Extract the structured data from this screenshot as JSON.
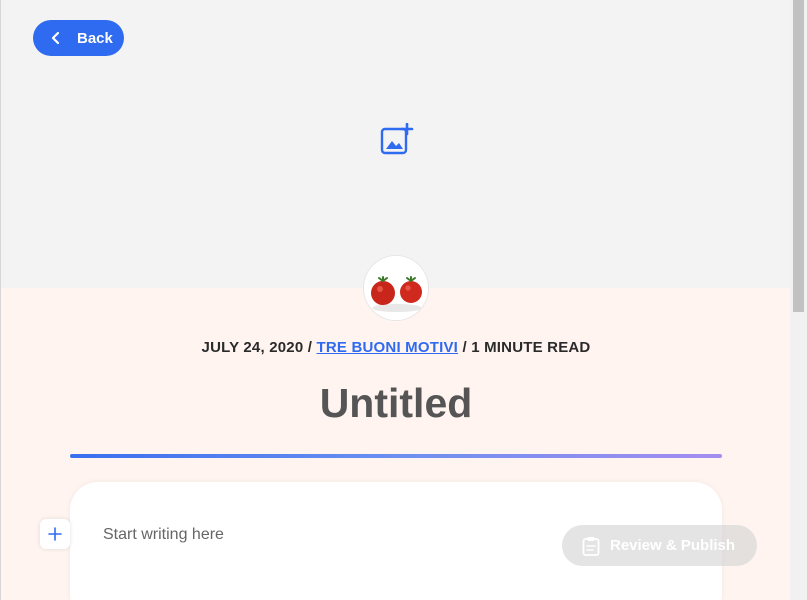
{
  "header": {
    "back_label": "Back"
  },
  "post": {
    "date": "JULY 24, 2020",
    "separator": "/",
    "category": "TRE BUONI MOTIVI",
    "read_time": "1 MINUTE READ",
    "title": "Untitled"
  },
  "editor": {
    "placeholder": "Start writing here"
  },
  "actions": {
    "publish_label": "Review & Publish"
  },
  "colors": {
    "accent": "#2f6bf0",
    "cover_bg": "#f3f3f4",
    "page_bg": "#fff4f0"
  },
  "icons": {
    "back": "chevron-left-icon",
    "add_image": "add-image-icon",
    "add_block": "plus-icon",
    "publish": "clipboard-icon"
  }
}
